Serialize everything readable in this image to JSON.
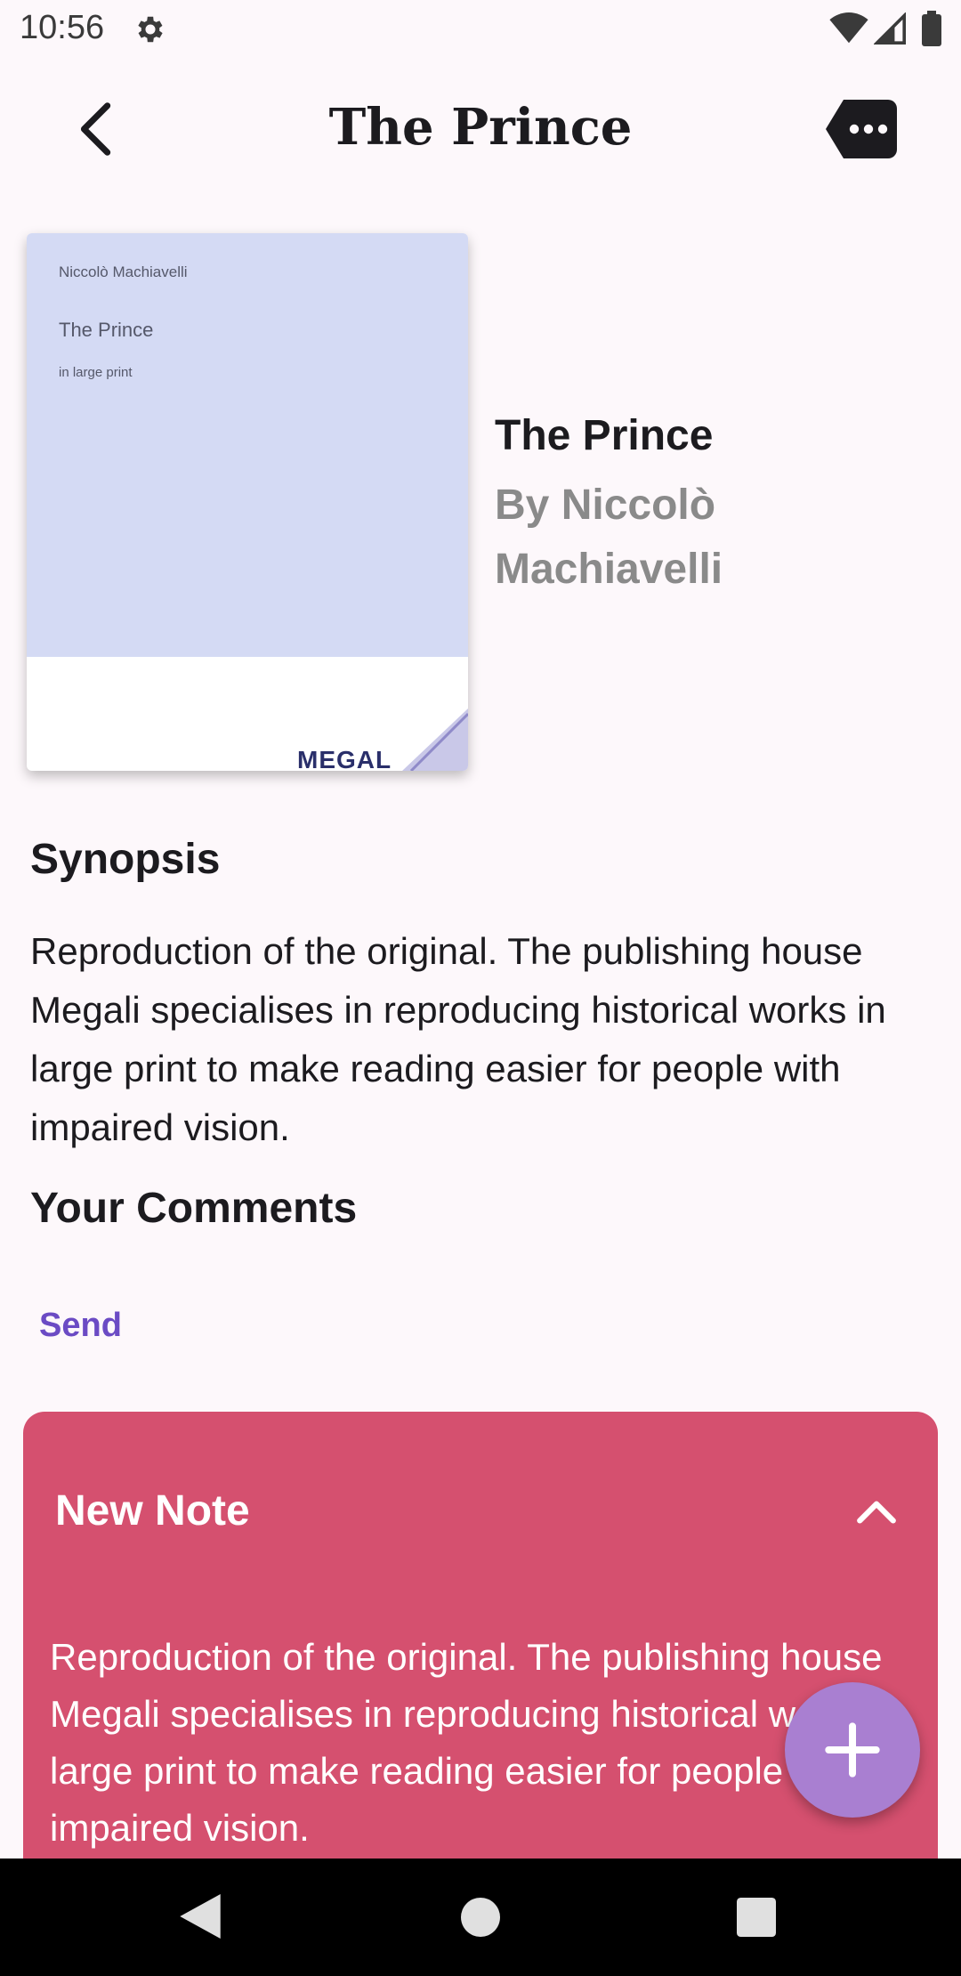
{
  "status_bar": {
    "time": "10:56"
  },
  "app_bar": {
    "title": "The Prince"
  },
  "book": {
    "cover": {
      "author": "Niccolò Machiavelli",
      "title": "The Prince",
      "subtitle": "in large print",
      "publisher": "MEGAL"
    },
    "title": "The Prince",
    "author": "By Niccolò Machiavelli"
  },
  "synopsis": {
    "heading": "Synopsis",
    "text": "Reproduction of the original. The publishing house Megali specialises in reproducing historical works in large print to make reading easier for people with impaired vision."
  },
  "comments": {
    "heading": "Your Comments",
    "send_label": "Send"
  },
  "note": {
    "title": "New Note",
    "body": "Reproduction of the original. The publishing house Megali specialises in reproducing historical works in large print to make reading easier for people with impaired vision."
  },
  "colors": {
    "note_card": "#d5506f",
    "fab": "#a97fd1",
    "send_text": "#6b4bc4",
    "cover_top": "#d4daf4"
  },
  "icons": [
    "gear-icon",
    "wifi-icon",
    "signal-icon",
    "battery-icon",
    "back-arrow-icon",
    "comment-icon",
    "chevron-up-icon",
    "plus-icon",
    "nav-back-icon",
    "nav-home-icon",
    "nav-recents-icon"
  ]
}
